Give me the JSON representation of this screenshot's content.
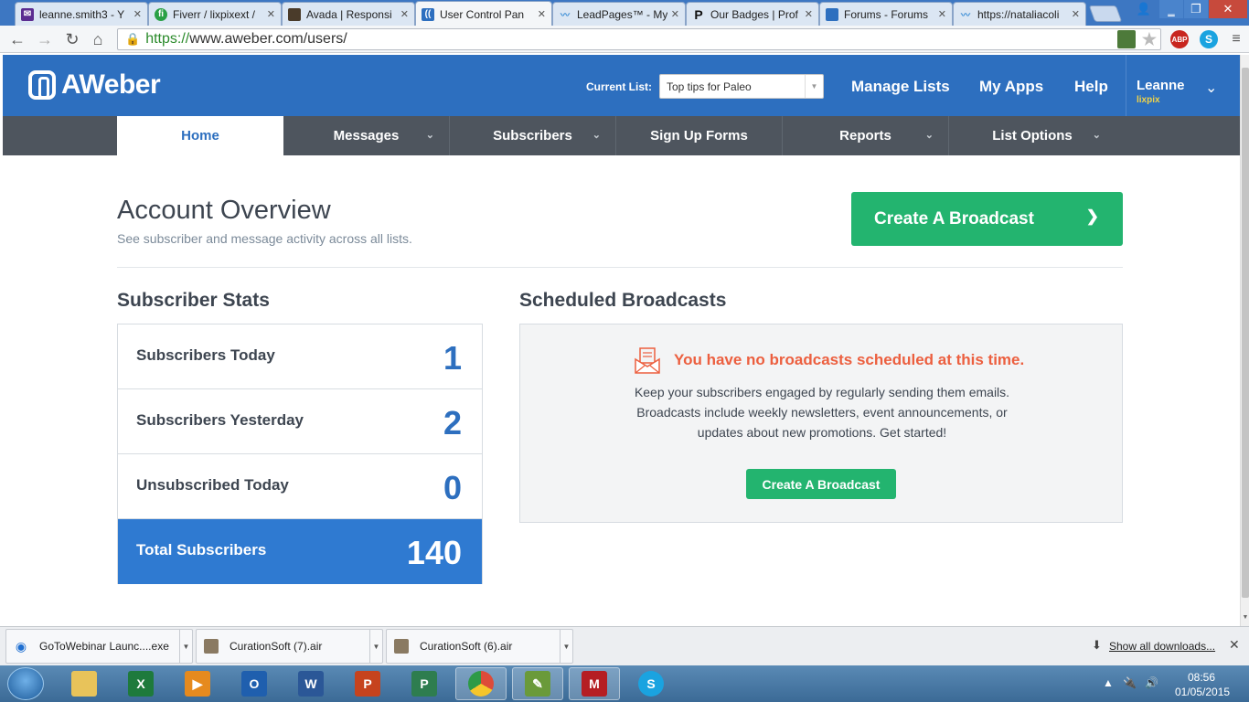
{
  "browser": {
    "tabs": [
      {
        "label": "leanne.smith3 - Y",
        "favicon": "mail-icon",
        "color": "#5b2c91"
      },
      {
        "label": "Fiverr / lixpixext /",
        "favicon": "fiverr-icon",
        "color": "#2aa046"
      },
      {
        "label": "Avada | Responsi",
        "favicon": "avada-icon",
        "color": "#4a3b2a"
      },
      {
        "label": "User Control Pan",
        "favicon": "aweber-icon",
        "color": "#2d6fbf"
      },
      {
        "label": "LeadPages™ - My",
        "favicon": "leadpages-icon",
        "color": "#3b8dd6"
      },
      {
        "label": "Our Badges | Prof",
        "favicon": "p-icon",
        "color": "#111111"
      },
      {
        "label": "Forums - Forums",
        "favicon": "forum-icon",
        "color": "#2d6fbf"
      },
      {
        "label": "https://nataliacoli",
        "favicon": "leadpages-icon",
        "color": "#3b8dd6"
      }
    ],
    "url_scheme": "https://",
    "url_rest": "www.aweber.com/users/",
    "ext_abp": "ABP"
  },
  "header": {
    "logo_text": "AWeber",
    "current_list_label": "Current List:",
    "current_list_value": "Top tips for Paleo",
    "nav": [
      "Manage Lists",
      "My Apps",
      "Help"
    ],
    "user_name": "Leanne",
    "user_sub": "lixpix"
  },
  "subnav": [
    {
      "label": "Home",
      "active": true,
      "dropdown": false
    },
    {
      "label": "Messages",
      "active": false,
      "dropdown": true
    },
    {
      "label": "Subscribers",
      "active": false,
      "dropdown": true
    },
    {
      "label": "Sign Up Forms",
      "active": false,
      "dropdown": false
    },
    {
      "label": "Reports",
      "active": false,
      "dropdown": true
    },
    {
      "label": "List Options",
      "active": false,
      "dropdown": true
    }
  ],
  "main": {
    "title": "Account Overview",
    "subtitle": "See subscriber and message activity across all lists.",
    "create_broadcast_label": "Create A Broadcast"
  },
  "stats": {
    "title": "Subscriber Stats",
    "rows": [
      {
        "label": "Subscribers Today",
        "value": "1"
      },
      {
        "label": "Subscribers Yesterday",
        "value": "2"
      },
      {
        "label": "Unsubscribed Today",
        "value": "0"
      },
      {
        "label": "Total Subscribers",
        "value": "140"
      }
    ]
  },
  "scheduled": {
    "title": "Scheduled Broadcasts",
    "empty_heading": "You have no broadcasts scheduled at this time.",
    "empty_body": "Keep your subscribers engaged by regularly sending them emails. Broadcasts include weekly newsletters, event announcements, or updates about new promotions. Get started!",
    "button_label": "Create A Broadcast"
  },
  "downloads": {
    "items": [
      "GoToWebinar Launc....exe",
      "CurationSoft (7).air",
      "CurationSoft (6).air"
    ],
    "show_all": "Show all downloads..."
  },
  "taskbar": {
    "time": "08:56",
    "date": "01/05/2015",
    "apps": [
      {
        "name": "explorer-icon",
        "letter": "",
        "color": "#e8c35a"
      },
      {
        "name": "excel-icon",
        "letter": "X",
        "color": "#1e7a3c"
      },
      {
        "name": "media-player-icon",
        "letter": "▶",
        "color": "#e68a1e"
      },
      {
        "name": "outlook-icon",
        "letter": "O",
        "color": "#1f5fae"
      },
      {
        "name": "word-icon",
        "letter": "W",
        "color": "#2b5797"
      },
      {
        "name": "powerpoint-icon",
        "letter": "P",
        "color": "#c6431e"
      },
      {
        "name": "project-icon",
        "letter": "P",
        "color": "#2e7d4f"
      },
      {
        "name": "chrome-icon",
        "letter": "",
        "color": "#dd4b39"
      },
      {
        "name": "camtasia-icon",
        "letter": "✎",
        "color": "#6a9a3a"
      },
      {
        "name": "mcafee-icon",
        "letter": "M",
        "color": "#b51e23"
      },
      {
        "name": "skype-icon",
        "letter": "S",
        "color": "#1aa3e0"
      }
    ]
  }
}
